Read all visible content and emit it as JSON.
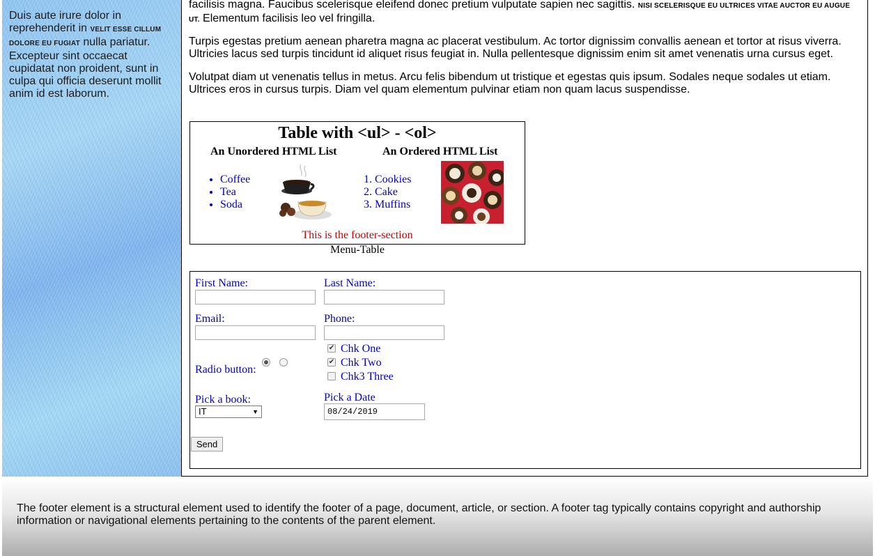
{
  "sidebar": {
    "text_before": "Duis aute irure dolor in reprehenderit in ",
    "text_smallcaps": "velit esse cillum dolore eu fugiat",
    "text_after": " nulla pariatur. Excepteur sint occaecat cupidatat non proident, sunt in culpa qui officia deserunt mollit anim id est laborum."
  },
  "main": {
    "p1_a": "facilisis magna. Faucibus scelerisque eleifend donec pretium vulputate sapien nec sagittis. ",
    "p1_small": "nisi scelerisque eu ultrices vitae auctor eu augue ut.",
    "p1_b": " Elementum facilisis leo vel fringilla.",
    "p2": "Turpis egestas pretium aenean pharetra magna ac placerat vestibulum. Ac tortor dignissim convallis aenean et tortor at risus viverra. Ultricies lacus sed turpis tincidunt id aliquet risus feugiat in. Nulla pellentesque dignissim enim sit amet venenatis urna cursus eget.",
    "p3": "Volutpat diam ut venenatis tellus in metus. Arcu felis bibendum ut tristique et egestas quis ipsum. Sodales neque sodales ut etiam. Ultrices eros in cursus turpis. Diam vel quam elementum pulvinar etiam non quam lacus suspendisse."
  },
  "menu_table": {
    "title": "Table with <ul> - <ol>",
    "ul_heading": "An Unordered HTML List",
    "ol_heading": "An Ordered HTML List",
    "ul_items": [
      "Coffee",
      "Tea",
      "Soda"
    ],
    "ol_items": [
      "Cookies",
      "Cake",
      "Muffins"
    ],
    "footer": "This is the footer-section",
    "caption": "Menu-Table"
  },
  "form": {
    "first_name_label": "First Name:",
    "last_name_label": "Last Name:",
    "email_label": "Email:",
    "phone_label": "Phone:",
    "radio_label": "Radio button:",
    "checkboxes": [
      {
        "label": "Chk One",
        "checked": true
      },
      {
        "label": "Chk Two",
        "checked": true
      },
      {
        "label": "Chk3 Three",
        "checked": false
      }
    ],
    "book_label": "Pick a book:",
    "book_value": "IT",
    "date_label": "Pick a Date",
    "date_value": "08/24/2019",
    "send_label": "Send"
  },
  "footer": {
    "text": "The footer element is a structural element used to identify the footer of a page, document, article, or section. A footer tag typically contains copyright and authorship information or navigational elements pertaining to the contents of the parent element."
  },
  "colors": {
    "link_blue": "#0000cc",
    "footer_red": "#cc0000"
  }
}
